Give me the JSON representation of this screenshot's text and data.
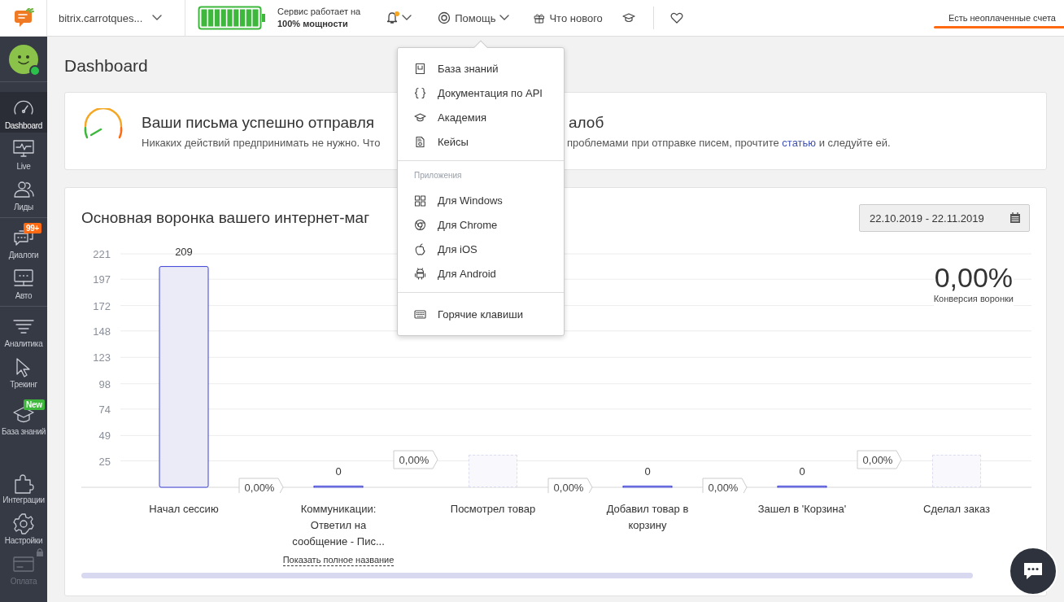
{
  "topbar": {
    "project": "bitrix.carrotques...",
    "battery": {
      "level": 1
    },
    "status_line": "Сервис работает на",
    "status_bold": "100% мощности",
    "notifications": {
      "unread": true
    },
    "help": {
      "label": "Помощь",
      "expanded": true
    },
    "whats_new": "Что нового",
    "billing_alert": "Есть неоплаченные счета"
  },
  "sidebar": {
    "avatar_online": true,
    "groups": [
      {
        "divided": true,
        "items": [
          {
            "label": "Dashboard",
            "selected": true,
            "disabled": false
          },
          {
            "label": "Live",
            "selected": false,
            "disabled": false
          },
          {
            "label": "Лиды",
            "selected": false,
            "disabled": false
          }
        ]
      },
      {
        "divided": true,
        "items": [
          {
            "label": "Диалоги",
            "selected": false,
            "disabled": false,
            "badge": {
              "text": "99+",
              "color": "#ff6a13"
            }
          },
          {
            "label": "Авто",
            "selected": false,
            "disabled": false
          }
        ]
      },
      {
        "divided": true,
        "items": [
          {
            "label": "Аналитика",
            "selected": false,
            "disabled": false
          },
          {
            "label": "Трекинг",
            "selected": false,
            "disabled": false
          }
        ]
      },
      {
        "divided": false,
        "items": [
          {
            "label": "База знаний",
            "selected": false,
            "disabled": false,
            "badge": {
              "text": "New",
              "color": "#3db83d"
            }
          }
        ]
      },
      {
        "divided": false,
        "items": [
          {
            "label": "Интеграции",
            "selected": false,
            "disabled": false
          },
          {
            "label": "Настройки",
            "selected": false,
            "disabled": false
          },
          {
            "label": "Оплата",
            "selected": false,
            "disabled": true
          }
        ]
      }
    ]
  },
  "page_title": "Dashboard",
  "delivery_card": {
    "title_left": "Ваши письма успешно отправля",
    "title_right": "алоб",
    "text_left": "Никаких действий предпринимать не нужно. Что",
    "text_right": "проблемами при отправке писем, прочтите",
    "link": "статью",
    "text_end": "и следуйте ей."
  },
  "funnel": {
    "title": "Основная воронка вашего интернет-маг",
    "date_range": "22.10.2019 - 22.11.2019",
    "conversion": "0,00%",
    "conversion_label": "Конверсия воронки",
    "chart_data": {
      "type": "bar",
      "categories": [
        "Начал сессию",
        "Коммуникации: Ответил на сообщение - Пис...",
        "Посмотрел товар",
        "Добавил товар в корзину",
        "Зашел в 'Корзина'",
        "Сделал заказ"
      ],
      "values": [
        209,
        0,
        null,
        0,
        0,
        null
      ],
      "ylim": [
        0,
        221
      ],
      "yticks": [
        25,
        49,
        74,
        98,
        123,
        148,
        172,
        197,
        221
      ],
      "data_labels": true,
      "grid": true
    },
    "step_conversions": [
      "0,00%",
      "0,00%",
      "0,00%",
      "0,00%",
      "0,00%"
    ],
    "show_full_name": "Показать полное название"
  },
  "help_menu": {
    "groups": [
      {
        "items": [
          "База знаний",
          "Документация по API",
          "Академия",
          "Кейсы"
        ]
      },
      {
        "header": "Приложения",
        "items": [
          "Для Windows",
          "Для Chrome",
          "Для iOS",
          "Для Android"
        ]
      },
      {
        "items": [
          "Горячие клавиши"
        ]
      }
    ]
  }
}
